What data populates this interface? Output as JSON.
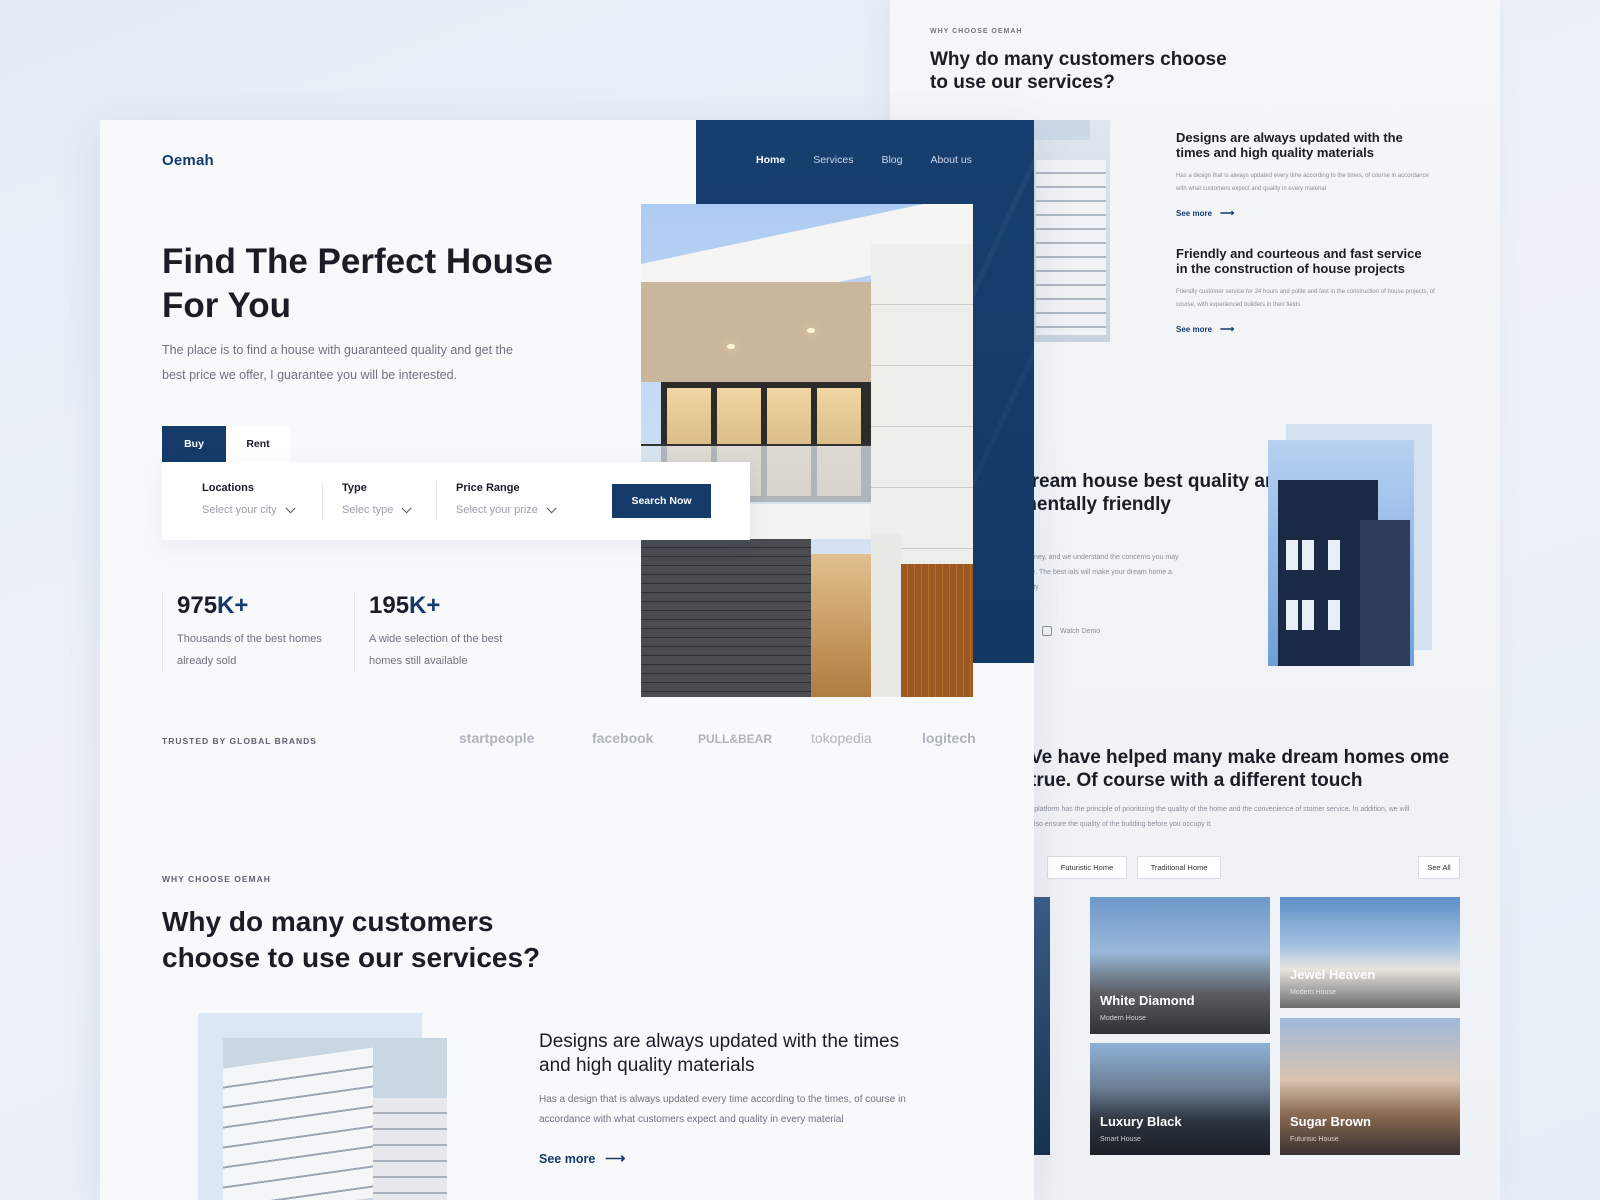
{
  "back_page": {
    "eyebrow": "WHY CHOOSE OEMAH",
    "heading": "Why do many customers choose to use our services?",
    "features": [
      {
        "title": "Designs are always updated with the times and high quality materials",
        "desc": "Has a design that is always updated every time according to the times, of course in accordance with what customers expect and quality in every material",
        "link": "See more"
      },
      {
        "title": "Friendly and courteous and fast service in the construction of house projects",
        "desc": "Friendly customer service for 24 hours and polite and fast in the construction of house projects, of course, with experienced builders in their fields",
        "link": "See more"
      }
    ],
    "dream_heading": "dream house best quality and mentally friendly",
    "dream_desc": "r money, and we understand the concerns you may have. The best ials will make your dream home a reality.",
    "watch_demo": "Watch Demo",
    "helped_heading": "Ve have helped many make dream homes ome true. Of course with a different touch",
    "helped_desc": "r platform has the principle of prioritizing the quality of the home and the convenience of stomer service. In addition, we will also ensure the quality of the building before you occupy it.",
    "filters": [
      "Futuristic Home",
      "Traditional Home"
    ],
    "see_all": "See All",
    "cards": [
      {
        "name": "White Diamond",
        "type": "Modern House"
      },
      {
        "name": "Jewel Heaven",
        "type": "Modern House"
      },
      {
        "name": "Luxury Black",
        "type": "Smart House"
      },
      {
        "name": "Sugar Brown",
        "type": "Futurisic House"
      }
    ]
  },
  "front_page": {
    "logo": "Oemah",
    "nav": [
      "Home",
      "Services",
      "Blog",
      "About us"
    ],
    "hero_title": "Find The Perfect House For You",
    "hero_sub": "The place is to find a house with guaranteed quality and get the best price we offer, I guarantee you will be interested.",
    "tabs": {
      "buy": "Buy",
      "rent": "Rent"
    },
    "search": {
      "location_label": "Locations",
      "location_value": "Select your city",
      "type_label": "Type",
      "type_value": "Selec type",
      "price_label": "Price Range",
      "price_value": "Select your prize",
      "button": "Search Now"
    },
    "stats": [
      {
        "value": "975",
        "suffix": "K+",
        "desc": "Thousands of the best homes already sold"
      },
      {
        "value": "195",
        "suffix": "K+",
        "desc": "A wide selection of the best homes still available"
      }
    ],
    "trusted_label": "TRUSTED BY GLOBAL BRANDS",
    "brands": [
      "startpeople",
      "facebook",
      "PULL&BEAR",
      "tokopedia",
      "logitech"
    ],
    "why_eyebrow": "WHY CHOOSE OEMAH",
    "why_title": "Why do many customers choose to use our services?",
    "why_feature_title": "Designs are always updated with the times and high quality materials",
    "why_feature_desc": "Has a design that is always updated every time according to the times, of course in accordance with what customers expect and quality in every material",
    "why_see_more": "See more"
  },
  "colors": {
    "accent": "#153b6b",
    "background": "#f8f9fb",
    "text": "#1a1d26",
    "muted": "#6d7380"
  }
}
